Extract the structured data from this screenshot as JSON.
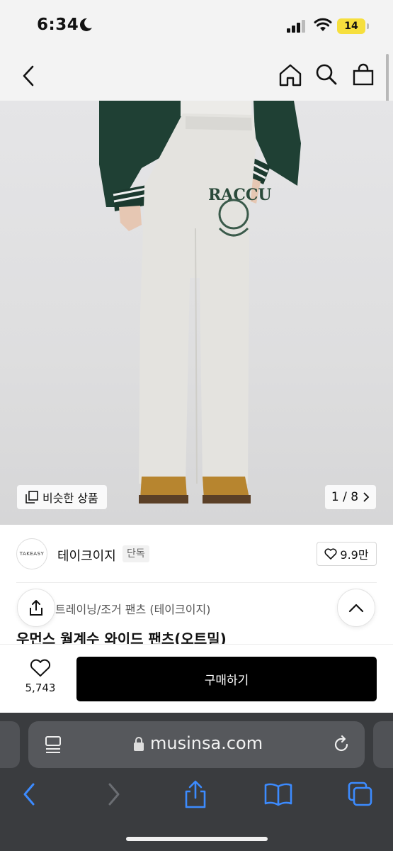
{
  "status_bar": {
    "time": "6:34",
    "battery": "14"
  },
  "product": {
    "image_counter": "1 / 8",
    "similar_label": "비슷한 상품",
    "brand_logo_text": "TAKEASY",
    "brand_name": "테이크이지",
    "brand_badge": "단독",
    "brand_likes": "9.9만",
    "category": "트레이닝/조거 팬츠 (테이크이지)",
    "title": "우먼스 월계수 와이드 팬츠(오트밀)",
    "print_text": "RACCU"
  },
  "buy_bar": {
    "wish_count": "5,743",
    "buy_label": "구매하기"
  },
  "safari": {
    "url": "musinsa.com"
  },
  "colors": {
    "jacket": "#1f4034",
    "pants": "#e4e3df",
    "accent_buy": "#000000"
  }
}
